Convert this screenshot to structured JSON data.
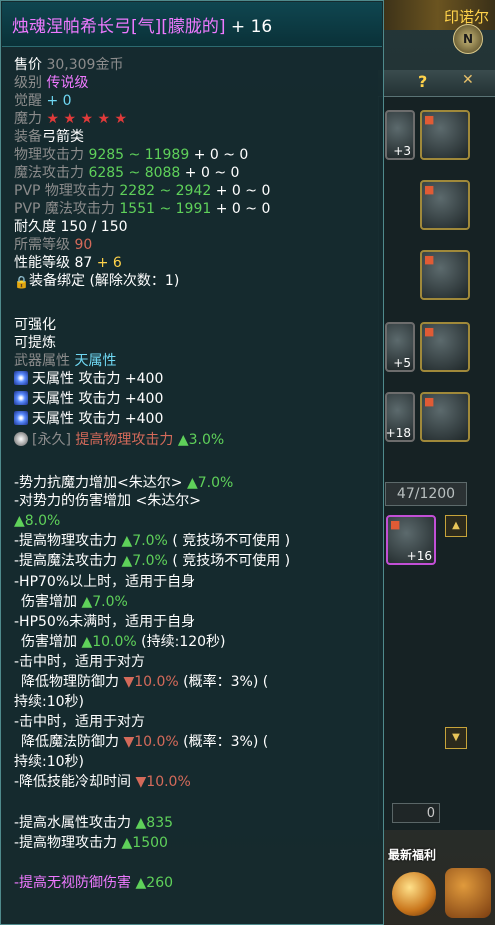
{
  "scene": {
    "city_label": "印诺尔",
    "compass": "N",
    "bag_counter": "47/1200",
    "slot_numbers": [
      "+3",
      "+5",
      "+18",
      "+16"
    ],
    "zero_field": "0",
    "new_welfare": "最新福利"
  },
  "tooltip": {
    "title": "烛魂涅帕希长弓[气][朦胧的]",
    "title_plus": " + 16",
    "price_label": "售价",
    "price_value": "30,309金币",
    "grade_label": "级别",
    "grade_value": "传说级",
    "awaken_label": "觉醒",
    "awaken_value": "+ 0",
    "magic_label": "魔力",
    "magic_stars": "★ ★ ★ ★ ★",
    "equip_label": "装备",
    "equip_value": "弓箭类",
    "phys_label": "物理攻击力",
    "phys_value": "9285 ~ 11989",
    "phys_bonus": "+ 0 ~ 0",
    "mag_label": "魔法攻击力",
    "mag_value": "6285 ~ 8088",
    "mag_bonus": "+ 0 ~ 0",
    "pvp_phys_label": "PVP 物理攻击力",
    "pvp_phys_value": "2282 ~ 2942",
    "pvp_phys_bonus": "+ 0 ~ 0",
    "pvp_mag_label": "PVP 魔法攻击力",
    "pvp_mag_value": "1551 ~ 1991",
    "pvp_mag_bonus": "+ 0 ~ 0",
    "durability": "耐久度 150 / 150",
    "req_level_label": "所需等级",
    "req_level_value": "90",
    "perf_label": "性能等级",
    "perf_value": "87",
    "perf_bonus": "+ 6",
    "bind_text": "装备绑定 (解除次数：1)",
    "enhanceable": "可强化",
    "refinable": "可提炼",
    "weapon_attr_label": "武器属性",
    "weapon_attr_value": "天属性",
    "sky_lines": [
      "天属性 攻击力 +400",
      "天属性 攻击力 +400",
      "天属性 攻击力 +400"
    ],
    "perm_tag": "[永久]",
    "perm_text": "提高物理攻击力",
    "perm_value": "▲3.0%",
    "effects": [
      {
        "text": "-势力抗魔力增加<朱达尔>",
        "value": "▲7.0%",
        "extra": ""
      },
      {
        "text": "-对势力的伤害增加 <朱达尔>",
        "value": "",
        "extra": ""
      },
      {
        "text": "",
        "value": "▲8.0%",
        "extra": ""
      },
      {
        "text": "-提高物理攻击力",
        "value": "▲7.0%",
        "extra": "( 竞技场不可使用 )"
      },
      {
        "text": "-提高魔法攻击力",
        "value": "▲7.0%",
        "extra": "( 竞技场不可使用 )"
      },
      {
        "text": "-HP70%以上时，适用于自身",
        "value": "",
        "extra": ""
      },
      {
        "text": "伤害增加",
        "value": "▲7.0%",
        "extra": ""
      },
      {
        "text": "-HP50%未满时，适用于自身",
        "value": "",
        "extra": ""
      },
      {
        "text": "伤害增加",
        "value": "▲10.0%",
        "extra": "(持续:120秒)"
      },
      {
        "text": "-击中时，适用于对方",
        "value": "",
        "extra": ""
      },
      {
        "text": "降低物理防御力",
        "value": "▼10.0%",
        "extra": "(概率：3%) ("
      },
      {
        "text": "持续:10秒)",
        "value": "",
        "extra": ""
      },
      {
        "text": "-击中时，适用于对方",
        "value": "",
        "extra": ""
      },
      {
        "text": "降低魔法防御力",
        "value": "▼10.0%",
        "extra": "(概率：3%) ("
      },
      {
        "text": "持续:10秒)",
        "value": "",
        "extra": ""
      },
      {
        "text": "-降低技能冷却时间",
        "value": "▼10.0%",
        "extra": ""
      }
    ],
    "water_text": "-提高水属性攻击力",
    "water_value": "▲835",
    "phys2_text": "-提高物理攻击力",
    "phys2_value": "▲1500",
    "ignore_text": "-提高无视防御伤害",
    "ignore_value": "▲260"
  },
  "colors": {
    "title": "#ee79ff",
    "green": "#5fd15a",
    "red": "#e03a3a",
    "cyan": "#6fd7f2",
    "tooltip_bg": "#142a2e"
  }
}
